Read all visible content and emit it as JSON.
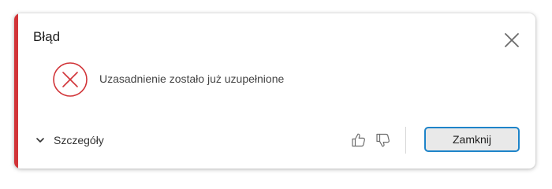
{
  "dialog": {
    "title": "Błąd",
    "message": "Uzasadnienie zostało już uzupełnione",
    "details_label": "Szczegóły",
    "close_button_label": "Zamknij",
    "accent_color": "#d13438",
    "button_border_color": "#1e84c9",
    "icons": {
      "status": "error-circle-x-icon",
      "close": "close-icon",
      "expand": "chevron-down-icon",
      "like": "thumbs-up-icon",
      "dislike": "thumbs-down-icon"
    }
  }
}
